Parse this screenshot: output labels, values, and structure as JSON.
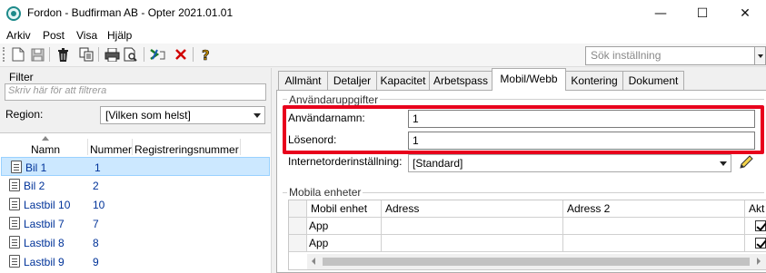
{
  "window": {
    "title": "Fordon - Budfirman AB - Opter 2021.01.01",
    "minimize": "—",
    "maximize": "☐",
    "close": "✕"
  },
  "menu": [
    "Arkiv",
    "Post",
    "Visa",
    "Hjälp"
  ],
  "toolbar": {
    "search_placeholder": "Sök inställning"
  },
  "left": {
    "filter_label": "Filter",
    "filter_placeholder": "Skriv här för att filtrera",
    "region_label": "Region:",
    "region_value": "[Vilken som helst]",
    "columns": [
      "Namn",
      "Nummer",
      "Registreringsnummer"
    ],
    "rows": [
      {
        "name": "Bil 1",
        "number": "1",
        "selected": true
      },
      {
        "name": "Bil 2",
        "number": "2",
        "selected": false
      },
      {
        "name": "Lastbil 10",
        "number": "10",
        "selected": false
      },
      {
        "name": "Lastbil 7",
        "number": "7",
        "selected": false
      },
      {
        "name": "Lastbil 8",
        "number": "8",
        "selected": false
      },
      {
        "name": "Lastbil 9",
        "number": "9",
        "selected": false
      }
    ]
  },
  "tabs": [
    "Allmänt",
    "Detaljer",
    "Kapacitet",
    "Arbetspass",
    "Mobil/Webb",
    "Kontering",
    "Dokument"
  ],
  "active_tab": "Mobil/Webb",
  "user_group": {
    "legend": "Användaruppgifter",
    "username_label": "Användarnamn:",
    "username_value": "1",
    "password_label": "Lösenord:",
    "password_value": "1"
  },
  "internet_order": {
    "label": "Internetorderinställning:",
    "value": "[Standard]"
  },
  "mobile_units": {
    "legend": "Mobila enheter",
    "columns": [
      "Mobil enhet",
      "Adress",
      "Adress 2",
      "Akt"
    ],
    "rows": [
      {
        "unit": "App",
        "address": "",
        "address2": "",
        "active": true
      },
      {
        "unit": "App",
        "address": "",
        "address2": "",
        "active": true
      }
    ]
  },
  "colors": {
    "highlight": "#e8001c",
    "selection": "#cce8ff",
    "link_text": "#003399"
  }
}
